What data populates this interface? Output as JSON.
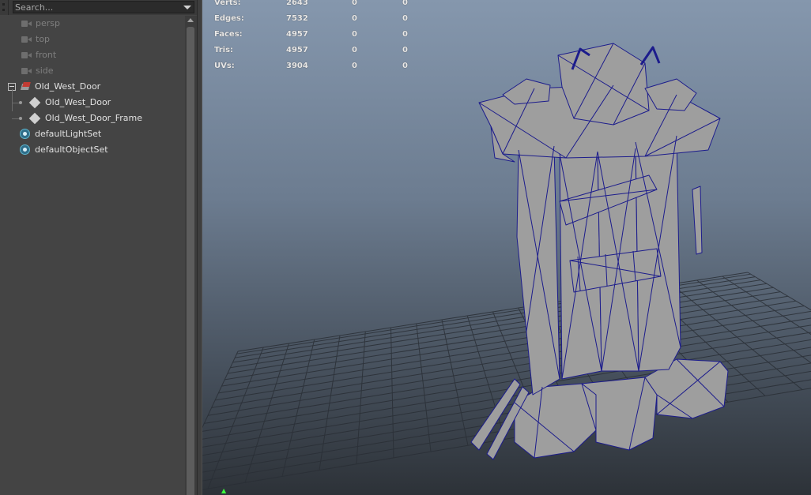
{
  "outliner": {
    "search_placeholder": "Search...",
    "items": [
      {
        "label": "persp",
        "type": "camera",
        "dim": true
      },
      {
        "label": "top",
        "type": "camera",
        "dim": true
      },
      {
        "label": "front",
        "type": "camera",
        "dim": true
      },
      {
        "label": "side",
        "type": "camera",
        "dim": true
      },
      {
        "label": "Old_West_Door",
        "type": "group",
        "expanded": true
      },
      {
        "label": "Old_West_Door",
        "type": "mesh",
        "child": true
      },
      {
        "label": "Old_West_Door_Frame",
        "type": "mesh",
        "child": true
      },
      {
        "label": "defaultLightSet",
        "type": "set"
      },
      {
        "label": "defaultObjectSet",
        "type": "set"
      }
    ]
  },
  "hud": {
    "rows": [
      {
        "label": "Verts:",
        "v1": "2643",
        "v2": "0",
        "v3": "0"
      },
      {
        "label": "Edges:",
        "v1": "7532",
        "v2": "0",
        "v3": "0"
      },
      {
        "label": "Faces:",
        "v1": "4957",
        "v2": "0",
        "v3": "0"
      },
      {
        "label": "Tris:",
        "v1": "4957",
        "v2": "0",
        "v3": "0"
      },
      {
        "label": "UVs:",
        "v1": "3904",
        "v2": "0",
        "v3": "0"
      }
    ]
  },
  "colors": {
    "wire": "#1c1c8c",
    "mesh_fill": "#9e9e9e",
    "grid": "#2a2f36",
    "axis_y": "#3cff3c"
  },
  "icons": {
    "camera": "camera-icon",
    "group": "group-icon",
    "mesh": "mesh-icon",
    "set": "object-set-icon"
  }
}
